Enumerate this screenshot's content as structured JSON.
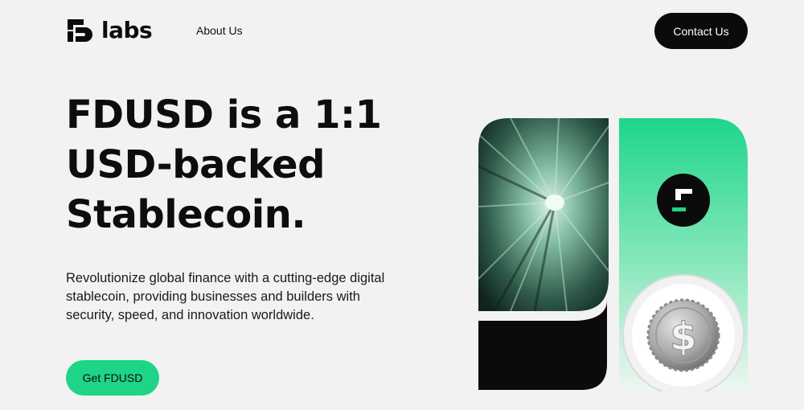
{
  "nav": {
    "brand": "labs",
    "about_label": "About Us",
    "contact_label": "Contact Us"
  },
  "hero": {
    "headline_lines": [
      "FDUSD is a 1:1",
      "USD-backed",
      "Stablecoin."
    ],
    "description": "Revolutionize global finance with a cutting-edge digital stablecoin, providing businesses and builders with security, speed, and innovation worldwide.",
    "cta_label": "Get FDUSD"
  },
  "colors": {
    "accent_green": "#1ed487",
    "dark": "#0b0b0b",
    "background": "#f2f2f2"
  },
  "icons": [
    "fd-logo-icon",
    "tunnel-image",
    "fdusd-token-icon",
    "dollar-coin-icon"
  ]
}
